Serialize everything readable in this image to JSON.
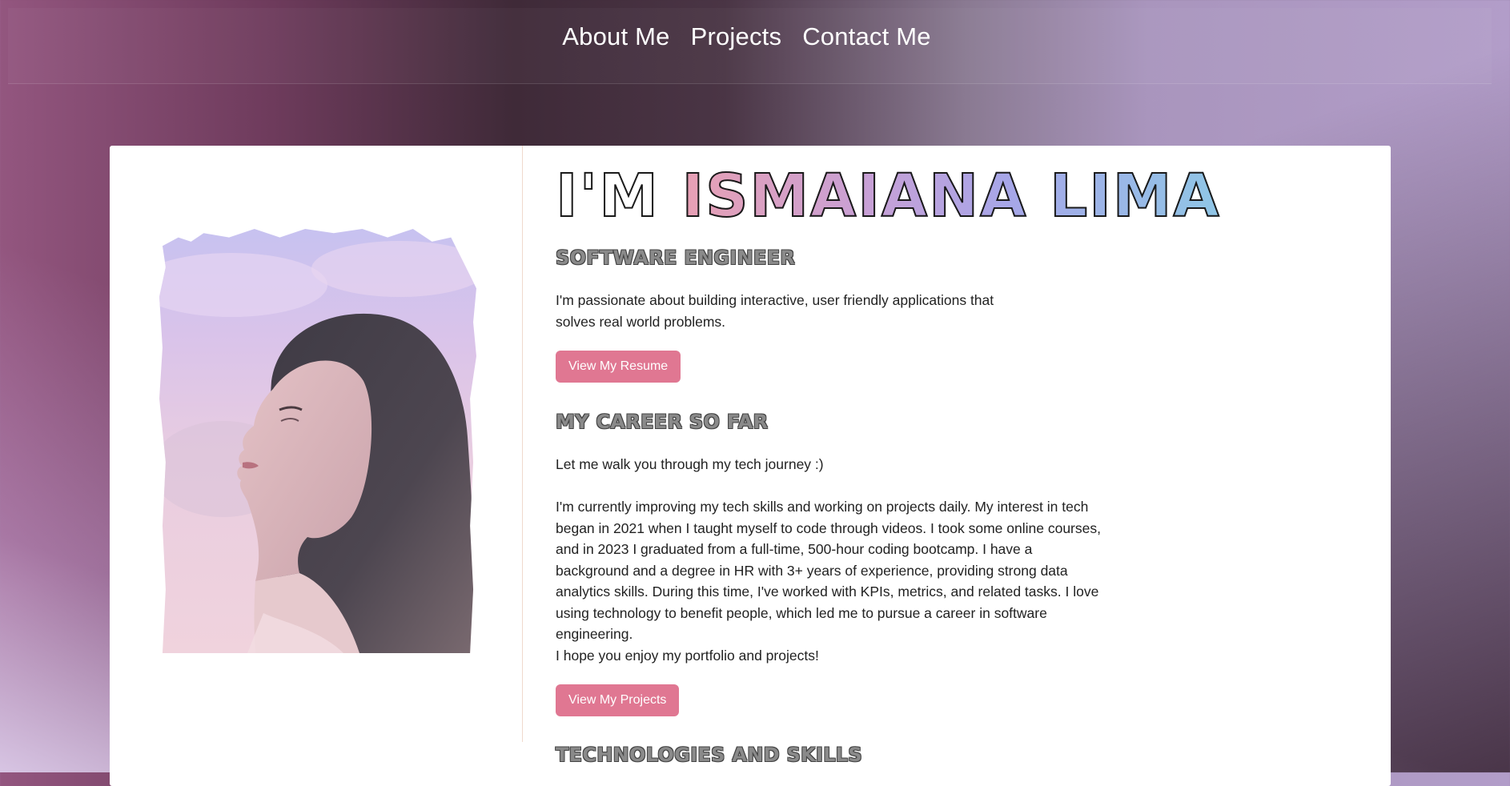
{
  "nav": {
    "items": [
      {
        "label": "About Me"
      },
      {
        "label": "Projects"
      },
      {
        "label": "Contact Me"
      }
    ]
  },
  "hero": {
    "prefix": "I'M ",
    "name": "ISMAIANA LIMA",
    "subtitle": "SOFTWARE ENGINEER",
    "intro": "I'm passionate about building interactive, user friendly applications that solves real world problems.",
    "resume_button": "View My Resume"
  },
  "career": {
    "title": "MY CAREER SO FAR",
    "lead": "Let me walk you through my tech journey :)",
    "body": "I'm currently improving my tech skills and working on projects daily. My interest in tech began in 2021 when I taught myself to code through videos. I took some online courses, and in 2023 I graduated from a full-time, 500-hour coding bootcamp. I have a background and a degree in HR with 3+ years of experience, providing strong data analytics skills. During this time, I've worked with KPIs, metrics, and related tasks. I love using technology to benefit people, which led me to pursue a career in software engineering.",
    "closing": "I hope you enjoy my portfolio and projects!",
    "projects_button": "View My Projects"
  },
  "skills": {
    "title": "TECHNOLOGIES AND SKILLS"
  },
  "colors": {
    "button": "#e07792",
    "name_gradient": [
      "#e8a0b4",
      "#c7a0d6",
      "#a7a6e8",
      "#8fc6e6"
    ]
  }
}
